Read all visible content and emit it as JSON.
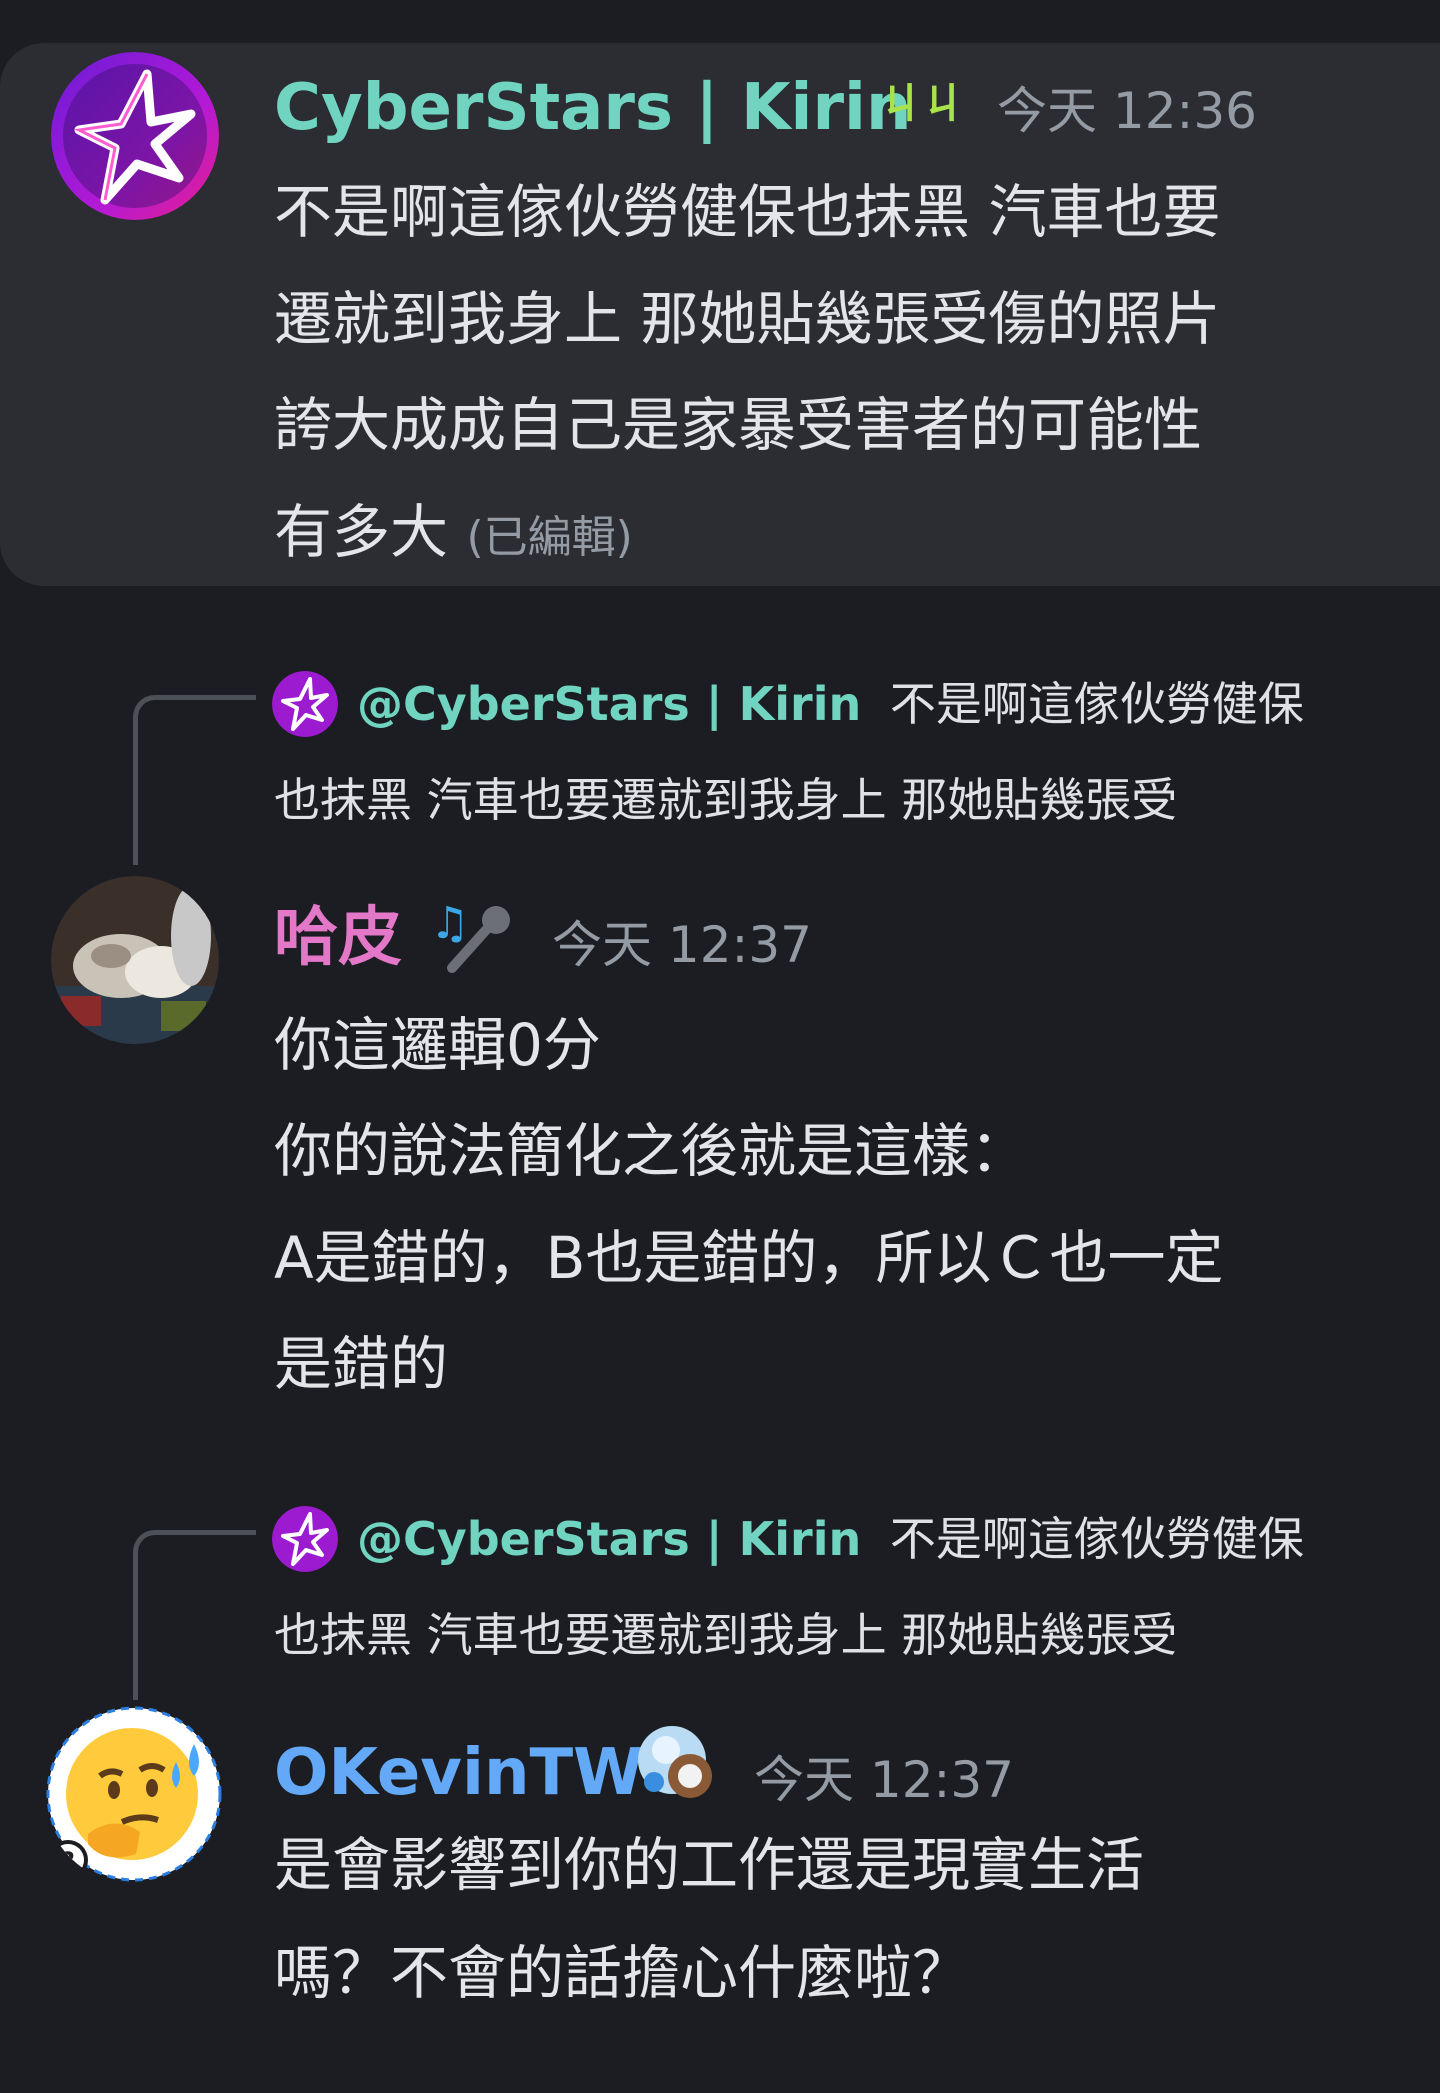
{
  "messages": [
    {
      "author": "CyberStars | Kirin",
      "author_color": "#70d4c1",
      "badge_text": "ㄐㄐ",
      "badge_color": "#a8e34a",
      "timestamp": "今天 12:36",
      "lines": [
        "不是啊這傢伙勞健保也抹黑 汽車也要",
        "遷就到我身上 那她貼幾張受傷的照片",
        "誇大成成自己是家暴受害者的可能性",
        "有多大"
      ],
      "edited_label": "(已編輯)",
      "avatar_icon": "star-logo-icon"
    },
    {
      "reply": {
        "mention": "@CyberStars | Kirin",
        "line1": "不是啊這傢伙勞健保",
        "line2": "也抹黑 汽車也要遷就到我身上 那她貼幾張受"
      },
      "author": "哈皮",
      "author_color": "#e278c7",
      "badge_icon": "microphone-music-icon",
      "timestamp": "今天 12:37",
      "lines": [
        "你這邏輯0分",
        "你的說法簡化之後就是這樣：",
        "A是錯的，B也是錯的，所以Ｃ也一定",
        "是錯的"
      ],
      "avatar_icon": "sleeping-cats-photo-avatar"
    },
    {
      "reply": {
        "mention": "@CyberStars | Kirin",
        "line1": "不是啊這傢伙勞健保",
        "line2": "也抹黑 汽車也要遷就到我身上 那她貼幾張受"
      },
      "author": "OKevinTW",
      "author_color": "#63a9f7",
      "badge_icon": "snowman-baseball-icon",
      "timestamp": "今天 12:37",
      "lines": [
        "是會影響到你的工作還是現實生活",
        "嗎？不會的話擔心什麼啦？"
      ],
      "avatar_icon": "thinking-sweat-emoji-avatar"
    }
  ]
}
